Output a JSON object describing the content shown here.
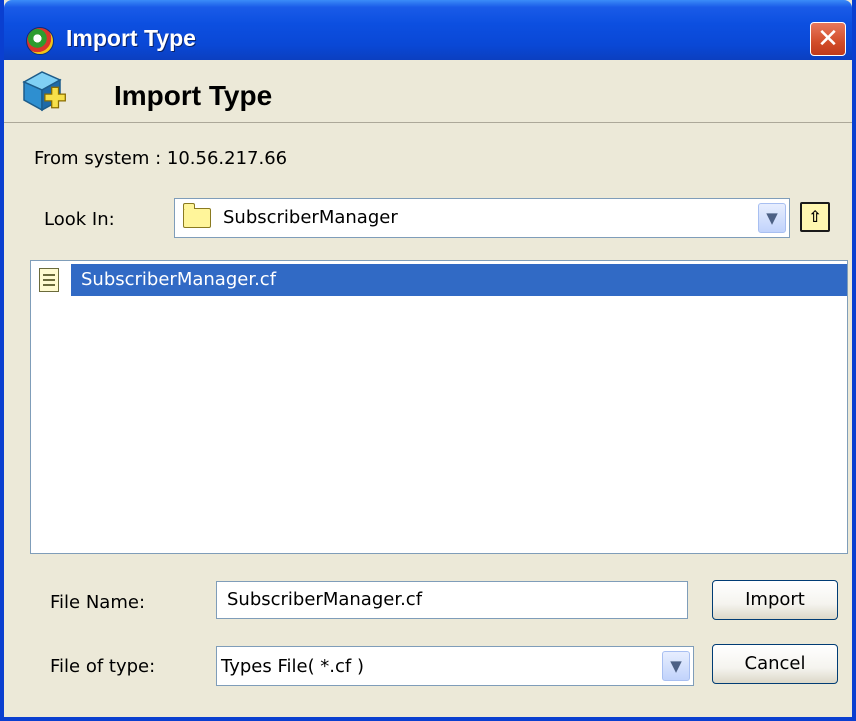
{
  "window": {
    "title": "Import Type"
  },
  "header": {
    "title": "Import Type"
  },
  "from_system": {
    "label": "From system :  10.56.217.66"
  },
  "look_in": {
    "label": "Look In:",
    "value": "SubscriberManager"
  },
  "file_list": {
    "items": [
      {
        "name": "SubscriberManager.cf",
        "selected": true
      }
    ]
  },
  "file_name": {
    "label": "File Name:",
    "value": "SubscriberManager.cf"
  },
  "file_type": {
    "label": "File of type:",
    "value": "Types File( *.cf )"
  },
  "buttons": {
    "import": "Import",
    "cancel": "Cancel"
  },
  "icons": {
    "app": "app-globe-icon",
    "header": "cube-add-icon",
    "folder": "folder-icon",
    "up_folder": "up-folder-icon",
    "document": "document-icon",
    "dropdown": "chevron-down-icon",
    "close": "close-icon"
  },
  "colors": {
    "titlebar": "#0a48d6",
    "selection": "#316ac5",
    "close": "#d24d2a"
  }
}
